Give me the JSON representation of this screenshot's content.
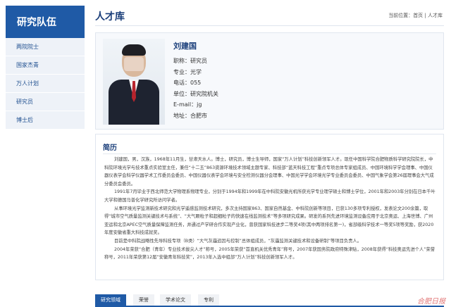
{
  "sidebar": {
    "title": "研究队伍",
    "items": [
      {
        "label": "两院院士"
      },
      {
        "label": "国家杰青"
      },
      {
        "label": "万人计划"
      },
      {
        "label": "研究员"
      },
      {
        "label": "博士后"
      }
    ]
  },
  "header": {
    "title": "人才库",
    "breadcrumb_prefix": "当前位置：",
    "breadcrumb_home": "首页",
    "breadcrumb_sep": " | ",
    "breadcrumb_current": "人才库"
  },
  "profile": {
    "name": "刘建国",
    "title_label": "职称：",
    "title_value": "研究员",
    "major_label": "专业：",
    "major_value": "光学",
    "phone_label": "电话：",
    "phone_value": "055",
    "unit_label": "单位：",
    "unit_value": "研究院机关",
    "email_label": "E-mail：",
    "email_value": "jg",
    "address_label": "地址：",
    "address_value": "合肥市"
  },
  "bio": {
    "title": "简历",
    "paragraphs": [
      "刘建国，男，汉族，1968年11月生，甘肃天水人。博士，研究员，博士生导师，国家“万人计划”科技创新领军人才。现任中国科学院合肥物质科学研究院院长，中科院环境光学与技术重点实验室主任，兼任“十二五”863资源环境技术领域主题专家、科技部“蓝天科技工程”重点专项总体专家组成员、中国环境科学学会理事、中国仪器仪表学会科学仪器学术工作委员会委员、中国仪器仪表学会环境与安全检测仪器分会理事、中国光学学会环境光学专业委员会委员、中国气象学会第26届理事会大气成分委员会委员。",
      "1991年7月毕业于西北师范大学物理系物理专业，分别于1994年和1999年在中科院安徽光机所获光学专业理学硕士和博士学位，2001年和2003年分别在日本千叶大学和德国马普化学研究所访问学者。",
      "从事环境光学监测新技术研究和光学遥感监测技术研究，多次主持国家863、国家自然基金、中科院创新等项目，已获130多项专利授权，发表论文200余篇，取得“城市空气质量监测关键技术与系统”、“大气颗粒子和超细粒子的快速在线监测技术”等多项研究成果。研发的系列先进环境监测设备应用于北京奥运、上海世博、广州亚运和北京APEC空气质量保障监测任务，并通过产学研合作实现产业化，曾获国家科技进步二等奖4项(其中两项排名第一)，省部级科学技术一等奖5项等奖励，获2020年度安徽省重大科技成就奖。",
      "目前是中科院战略性先导科技专项（B类）“大气灰霾追因与控制”总体组成员，“灰霾监测关键技术和设备研制”等项目负责人。",
      "2004年荣获“合肥（青年）专业技术拔尖人才”称号，2005年荣获“首直机关优秀青年”称号，2007年获国务院政府特殊津贴，2008年获得“科技奥运先进个人”荣誉称号，2011年荣获第12届“安徽青年科技奖”，2013年入选中组部“万人计划”科技创新领军人才。"
    ]
  },
  "tabs": [
    {
      "label": "研究领域",
      "active": true
    },
    {
      "label": "荣誉",
      "active": false
    },
    {
      "label": "学术论文",
      "active": false
    },
    {
      "label": "专利",
      "active": false
    }
  ],
  "watermark": "合肥日报",
  "colors": {
    "primary": "#1f5aa6",
    "sidebar_bg": "#eef2f8",
    "title": "#1a3e7a"
  }
}
